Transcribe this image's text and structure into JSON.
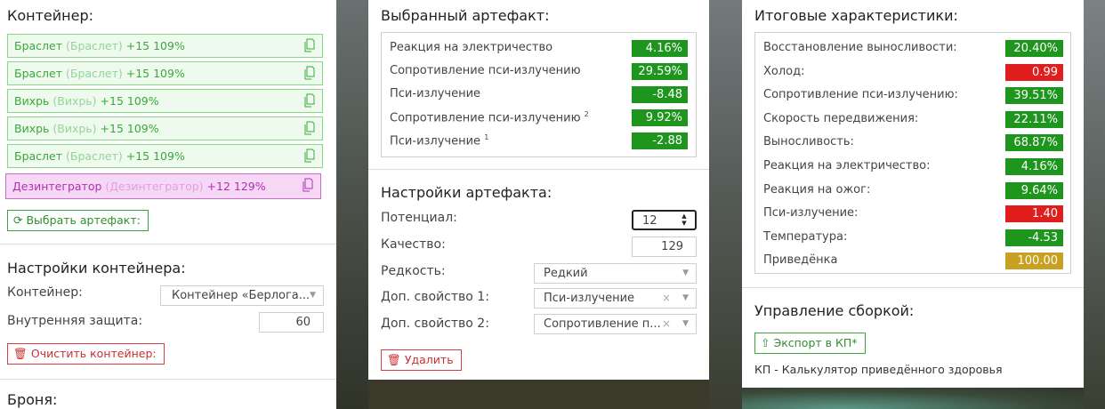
{
  "container": {
    "title": "Контейнер:",
    "items": [
      {
        "name": "Браслет",
        "orig": "(Браслет)",
        "value": "+15 109%"
      },
      {
        "name": "Браслет",
        "orig": "(Браслет)",
        "value": "+15 109%"
      },
      {
        "name": "Вихрь",
        "orig": "(Вихрь)",
        "value": "+15 109%"
      },
      {
        "name": "Вихрь",
        "orig": "(Вихрь)",
        "value": "+15 109%"
      },
      {
        "name": "Браслет",
        "orig": "(Браслет)",
        "value": "+15 109%"
      },
      {
        "name": "Дезинтегратор",
        "orig": "(Дезинтегратор)",
        "value": "+12 129%"
      }
    ],
    "select_button": "Выбрать артефакт:",
    "settings_title": "Настройки контейнера:",
    "container_label": "Контейнер:",
    "container_value": "Контейнер «Берлога...",
    "protection_label": "Внутренняя защита:",
    "protection_value": "60",
    "clear_button": "Очистить контейнер:",
    "armor_title": "Броня:"
  },
  "artifact": {
    "title": "Выбранный артефакт:",
    "stats": [
      {
        "label": "Реакция на электричество",
        "sup": "",
        "value": "4.16%",
        "color": "#1e961e"
      },
      {
        "label": "Сопротивление пси-излучению",
        "sup": "",
        "value": "29.59%",
        "color": "#1e961e"
      },
      {
        "label": "Пси-излучение",
        "sup": "",
        "value": "-8.48",
        "color": "#1e961e"
      },
      {
        "label": "Сопротивление пси-излучению",
        "sup": "2",
        "value": "9.92%",
        "color": "#1e961e"
      },
      {
        "label": "Пси-излучение",
        "sup": "1",
        "value": "-2.88",
        "color": "#1e961e"
      }
    ],
    "settings_title": "Настройки артефакта:",
    "potential_label": "Потенциал:",
    "potential_value": "12",
    "quality_label": "Качество:",
    "quality_value": "129",
    "rarity_label": "Редкость:",
    "rarity_value": "Редкий",
    "extra1_label": "Доп. свойство 1:",
    "extra1_value": "Пси-излучение",
    "extra2_label": "Доп. свойство 2:",
    "extra2_value": "Сопротивление п...",
    "delete_button": "Удалить"
  },
  "totals": {
    "title": "Итоговые характеристики:",
    "stats": [
      {
        "label": "Восстановление выносливости:",
        "value": "20.40%",
        "color": "#1e961e"
      },
      {
        "label": "Холод:",
        "value": "0.99",
        "color": "#e01e1e"
      },
      {
        "label": "Сопротивление пси-излучению:",
        "value": "39.51%",
        "color": "#1e961e"
      },
      {
        "label": "Скорость передвижения:",
        "value": "22.11%",
        "color": "#1e961e"
      },
      {
        "label": "Выносливость:",
        "value": "68.87%",
        "color": "#1e961e"
      },
      {
        "label": "Реакция на электричество:",
        "value": "4.16%",
        "color": "#1e961e"
      },
      {
        "label": "Реакция на ожог:",
        "value": "9.64%",
        "color": "#1e961e"
      },
      {
        "label": "Пси-излучение:",
        "value": "1.40",
        "color": "#e01e1e"
      },
      {
        "label": "Температура:",
        "value": "-4.53",
        "color": "#1e961e"
      },
      {
        "label": "Приведёнка",
        "value": "100.00",
        "color": "#c8a022"
      }
    ],
    "build_title": "Управление сборкой:",
    "export_button": "Экспорт в КП*",
    "note": "КП - Калькулятор приведённого здоровья"
  }
}
